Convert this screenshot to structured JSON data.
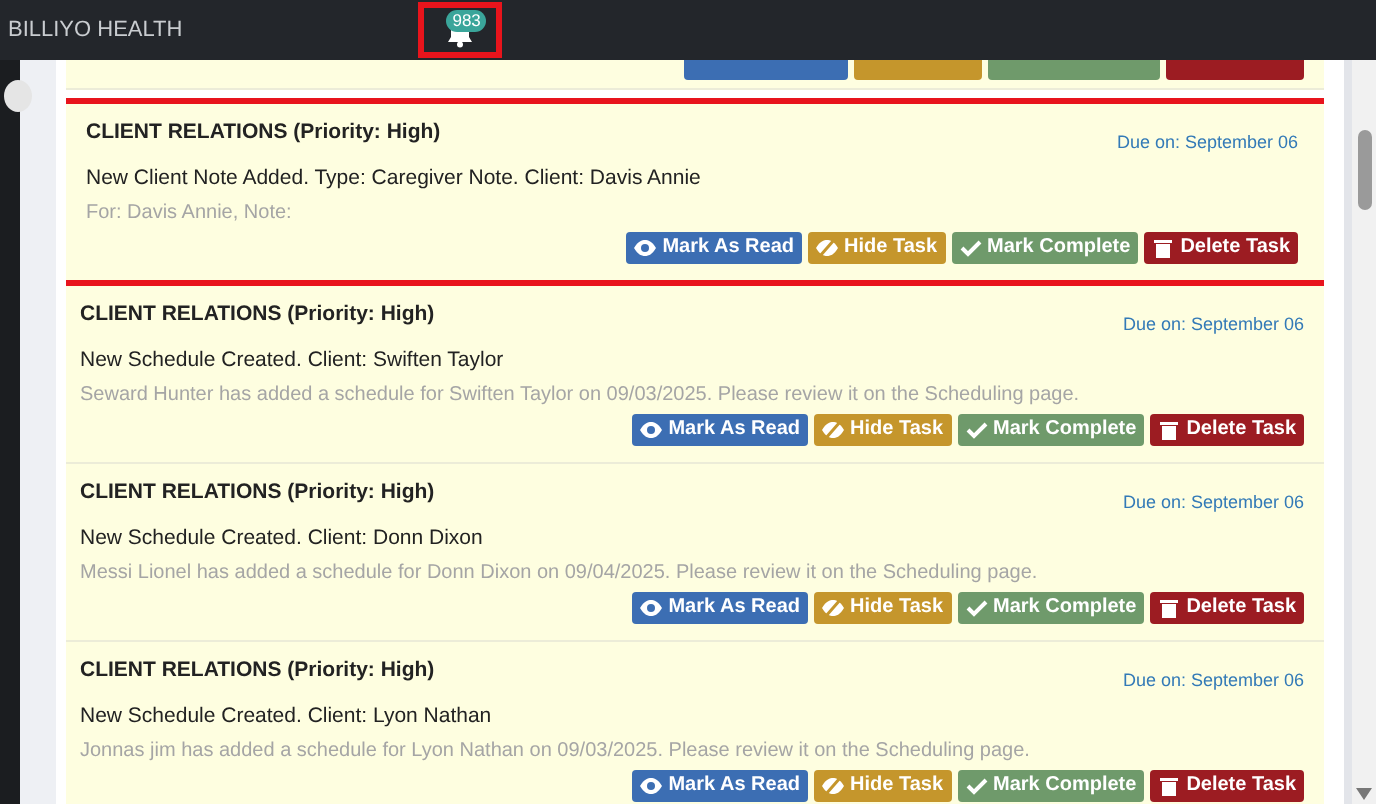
{
  "navbar": {
    "brand": "BILLIYO HEALTH",
    "notifications": {
      "count": "983",
      "highlighted": true
    }
  },
  "partial_top_buttons": [
    {
      "kind": "read"
    },
    {
      "kind": "hide"
    },
    {
      "kind": "complete"
    },
    {
      "kind": "delete"
    }
  ],
  "tasks": [
    {
      "category": "CLIENT RELATIONS",
      "priority": "(Priority: High)",
      "due": "Due on: September 06",
      "title": "New Client Note Added. Type: Caregiver Note. Client: Davis Annie",
      "detail": "For: Davis Annie, Note:",
      "highlighted": true,
      "buttons": [
        {
          "kind": "read",
          "label": "Mark As Read"
        },
        {
          "kind": "hide",
          "label": "Hide Task"
        },
        {
          "kind": "complete",
          "label": "Mark Complete"
        },
        {
          "kind": "delete",
          "label": "Delete Task"
        }
      ]
    },
    {
      "category": "CLIENT RELATIONS",
      "priority": "(Priority: High)",
      "due": "Due on: September 06",
      "title": "New Schedule Created. Client: Swiften Taylor",
      "detail": "Seward Hunter has added a schedule for Swiften Taylor on 09/03/2025. Please review it on the Scheduling page.",
      "highlighted": false,
      "buttons": [
        {
          "kind": "read",
          "label": "Mark As Read"
        },
        {
          "kind": "hide",
          "label": "Hide Task"
        },
        {
          "kind": "complete",
          "label": "Mark Complete"
        },
        {
          "kind": "delete",
          "label": "Delete Task"
        }
      ]
    },
    {
      "category": "CLIENT RELATIONS",
      "priority": "(Priority: High)",
      "due": "Due on: September 06",
      "title": "New Schedule Created. Client: Donn Dixon",
      "detail": "Messi Lionel has added a schedule for Donn Dixon on 09/04/2025. Please review it on the Scheduling page.",
      "highlighted": false,
      "buttons": [
        {
          "kind": "read",
          "label": "Mark As Read"
        },
        {
          "kind": "hide",
          "label": "Hide Task"
        },
        {
          "kind": "complete",
          "label": "Mark Complete"
        },
        {
          "kind": "delete",
          "label": "Delete Task"
        }
      ]
    },
    {
      "category": "CLIENT RELATIONS",
      "priority": "(Priority: High)",
      "due": "Due on: September 06",
      "title": "New Schedule Created. Client: Lyon Nathan",
      "detail": "Jonnas jim has added a schedule for Lyon Nathan on 09/03/2025. Please review it on the Scheduling page.",
      "highlighted": false,
      "buttons": [
        {
          "kind": "read",
          "label": "Mark As Read"
        },
        {
          "kind": "hide",
          "label": "Hide Task"
        },
        {
          "kind": "complete",
          "label": "Mark Complete"
        },
        {
          "kind": "delete",
          "label": "Delete Task"
        }
      ]
    }
  ]
}
